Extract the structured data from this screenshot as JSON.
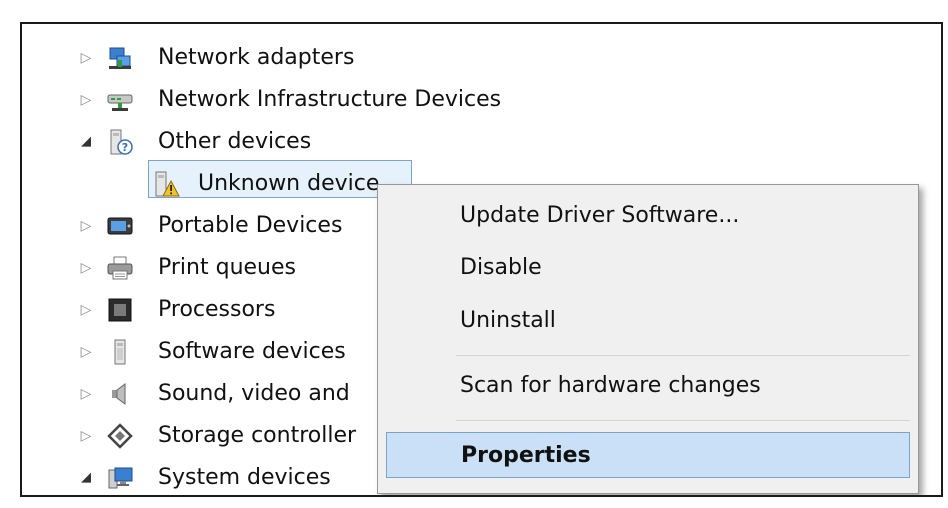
{
  "tree": {
    "items": [
      {
        "label": "Network adapters",
        "expander": "collapsed",
        "icon": "network-adapter-icon"
      },
      {
        "label": "Network Infrastructure Devices",
        "expander": "collapsed",
        "icon": "network-infrastructure-icon"
      },
      {
        "label": "Other devices",
        "expander": "expanded",
        "icon": "other-devices-icon"
      },
      {
        "label": "Unknown device",
        "expander": "none",
        "icon": "unknown-device-warning-icon",
        "selected": true
      },
      {
        "label": "Portable Devices",
        "expander": "collapsed",
        "icon": "portable-devices-icon"
      },
      {
        "label": "Print queues",
        "expander": "collapsed",
        "icon": "printer-icon"
      },
      {
        "label": "Processors",
        "expander": "collapsed",
        "icon": "processor-icon"
      },
      {
        "label": "Software devices",
        "expander": "collapsed",
        "icon": "software-device-icon"
      },
      {
        "label": "Sound, video and",
        "expander": "collapsed",
        "icon": "speaker-icon"
      },
      {
        "label": "Storage controller",
        "expander": "collapsed",
        "icon": "storage-controller-icon"
      },
      {
        "label": "System devices",
        "expander": "expanded",
        "icon": "system-devices-icon"
      }
    ]
  },
  "context_menu": {
    "items": [
      {
        "label": "Update Driver Software..."
      },
      {
        "label": "Disable"
      },
      {
        "label": "Uninstall"
      },
      {
        "label": "Scan for hardware changes"
      },
      {
        "label": "Properties",
        "highlighted": true
      }
    ]
  },
  "colors": {
    "menu_background": "#f0f0f0",
    "highlight_fill": "#c9e0f7",
    "highlight_border": "#7da2ce",
    "selection_fill": "#e5f1fb"
  }
}
